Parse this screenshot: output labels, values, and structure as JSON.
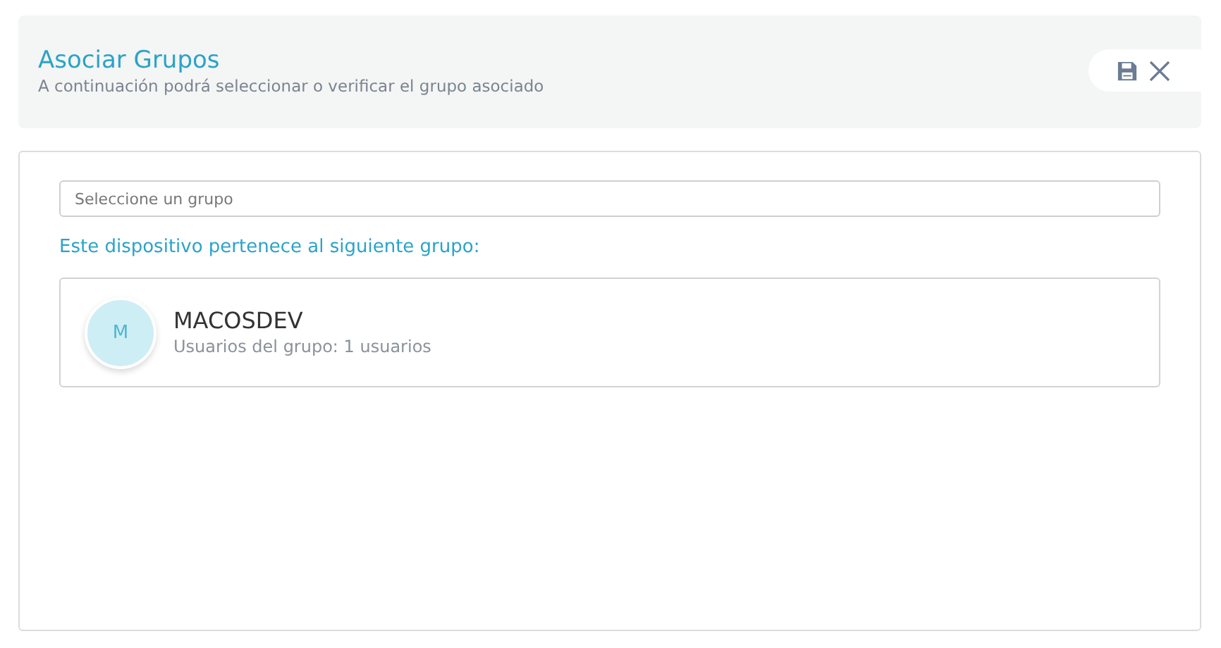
{
  "header": {
    "title": "Asociar Grupos",
    "subtitle": "A continuación podrá seleccionar o verificar el grupo asociado"
  },
  "group_select": {
    "placeholder": "Seleccione un grupo"
  },
  "assigned_label": "Este dispositivo pertenece al siguiente grupo:",
  "groups": [
    {
      "initial": "M",
      "name": "MACOSDEV",
      "detail": "Usuarios del grupo: 1 usuarios"
    }
  ]
}
